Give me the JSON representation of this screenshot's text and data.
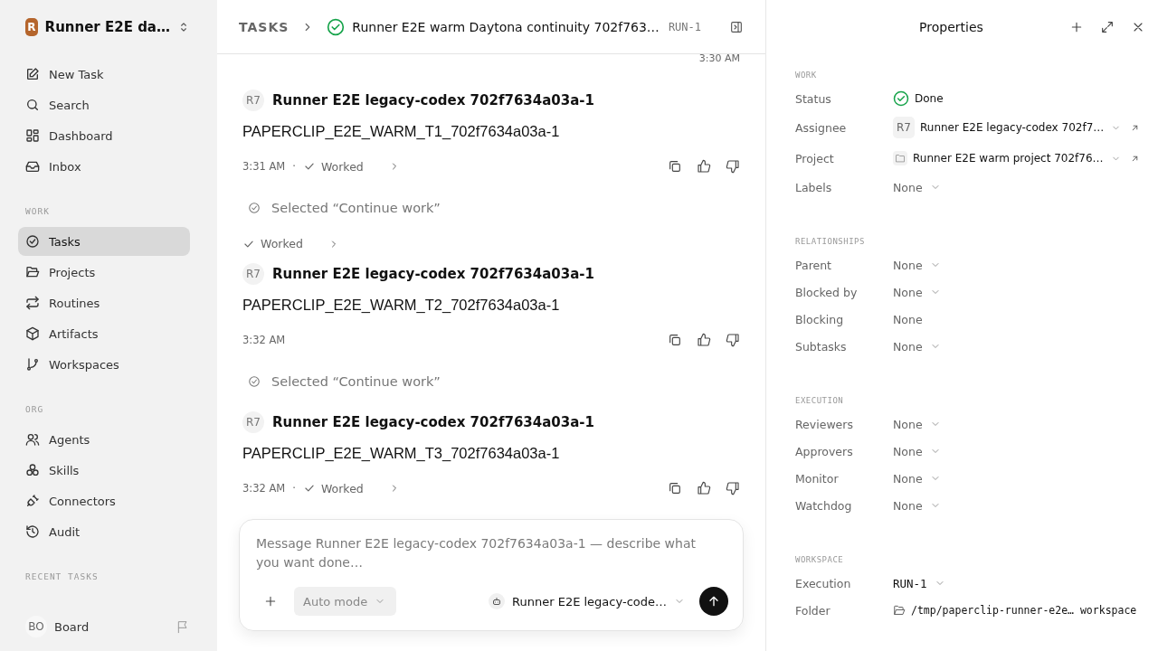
{
  "workspace": {
    "logo": "R",
    "name": "Runner E2E da…"
  },
  "nav": [
    {
      "label": "New Task",
      "selected": false
    },
    {
      "label": "Search",
      "selected": false
    },
    {
      "label": "Dashboard",
      "selected": false
    },
    {
      "label": "Inbox",
      "selected": false
    }
  ],
  "sections": [
    {
      "title": "WORK",
      "items": [
        {
          "label": "Tasks",
          "selected": true
        },
        {
          "label": "Projects",
          "selected": false
        },
        {
          "label": "Routines",
          "selected": false
        },
        {
          "label": "Artifacts",
          "selected": false
        },
        {
          "label": "Workspaces",
          "selected": false
        }
      ]
    },
    {
      "title": "ORG",
      "items": [
        {
          "label": "Agents",
          "selected": false
        },
        {
          "label": "Skills",
          "selected": false
        },
        {
          "label": "Connectors",
          "selected": false
        },
        {
          "label": "Audit",
          "selected": false
        }
      ]
    }
  ],
  "recent_tasks_title": "RECENT TASKS",
  "user": {
    "initials": "BO",
    "name": "Board"
  },
  "header": {
    "breadcrumb": "TASKS",
    "title": "Runner E2E warm Daytona continuity 702f763…",
    "run": "RUN-1"
  },
  "feed": [
    {
      "kind": "time",
      "time": "3:30 AM"
    },
    {
      "kind": "message",
      "avatar": "R7",
      "author": "Runner E2E legacy-codex 702f7634a03a-1",
      "body": "PAPERCLIP_E2E_WARM_T1_702f7634a03a-1",
      "time": "3:31 AM",
      "separator": "·",
      "status": "Worked"
    },
    {
      "kind": "selection",
      "text": "Selected “Continue work”"
    },
    {
      "kind": "status",
      "text": "Worked"
    },
    {
      "kind": "message",
      "avatar": "R7",
      "author": "Runner E2E legacy-codex 702f7634a03a-1",
      "body": "PAPERCLIP_E2E_WARM_T2_702f7634a03a-1",
      "time": "3:32 AM"
    },
    {
      "kind": "selection",
      "text": "Selected “Continue work”"
    },
    {
      "kind": "message",
      "avatar": "R7",
      "author": "Runner E2E legacy-codex 702f7634a03a-1",
      "body": "PAPERCLIP_E2E_WARM_T3_702f7634a03a-1",
      "time": "3:32 AM",
      "separator": "·",
      "status": "Worked"
    }
  ],
  "composer": {
    "placeholder": "Message Runner E2E legacy-codex 702f7634a03a-1 — describe what you want done…",
    "mode": "Auto mode",
    "agent": "Runner E2E legacy-code…"
  },
  "properties": {
    "title": "Properties",
    "sections": [
      {
        "title": "WORK",
        "rows": [
          {
            "label": "Status",
            "kind": "status",
            "value": "Done"
          },
          {
            "label": "Assignee",
            "kind": "agent",
            "avatar": "R7",
            "value": "Runner E2E legacy-codex 702f7…"
          },
          {
            "label": "Project",
            "kind": "project",
            "value": "Runner E2E warm project 702f76…"
          },
          {
            "label": "Labels",
            "kind": "select",
            "value": "None"
          }
        ]
      },
      {
        "title": "RELATIONSHIPS",
        "rows": [
          {
            "label": "Parent",
            "kind": "select",
            "value": "None"
          },
          {
            "label": "Blocked by",
            "kind": "select",
            "value": "None"
          },
          {
            "label": "Blocking",
            "kind": "plain",
            "value": "None"
          },
          {
            "label": "Subtasks",
            "kind": "select",
            "value": "None"
          }
        ]
      },
      {
        "title": "EXECUTION",
        "rows": [
          {
            "label": "Reviewers",
            "kind": "select",
            "value": "None"
          },
          {
            "label": "Approvers",
            "kind": "select",
            "value": "None"
          },
          {
            "label": "Monitor",
            "kind": "select",
            "value": "None"
          },
          {
            "label": "Watchdog",
            "kind": "select",
            "value": "None"
          }
        ]
      },
      {
        "title": "WORKSPACE",
        "rows": [
          {
            "label": "Execution",
            "kind": "run",
            "value": "RUN-1"
          },
          {
            "label": "Folder",
            "kind": "folder",
            "value": "/tmp/paperclip-runner-e2e… workspace"
          }
        ]
      }
    ]
  }
}
